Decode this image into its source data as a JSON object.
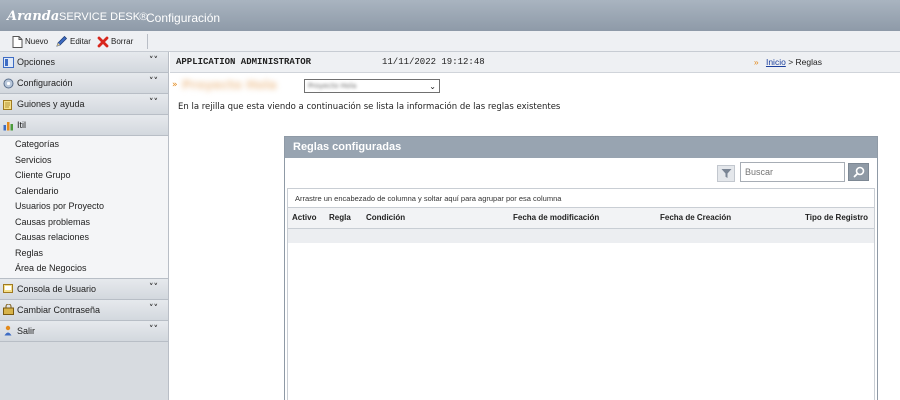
{
  "window": {
    "brand": "Aranda",
    "product": "SERVICE DESK",
    "registered": "®",
    "module": "Configuración"
  },
  "toolbar": {
    "new_label": "Nuevo",
    "edit_label": "Editar",
    "delete_label": "Borrar"
  },
  "sidebar": {
    "sections": [
      {
        "label": "Opciones",
        "icon": "options-icon"
      },
      {
        "label": "Configuración",
        "icon": "gear-icon"
      },
      {
        "label": "Guiones y ayuda",
        "icon": "script-help-icon"
      },
      {
        "label": "Itil",
        "icon": "itil-icon"
      }
    ],
    "itil_items": [
      "Categorías",
      "Servicios",
      "Cliente Grupo",
      "Calendario",
      "Usuarios por Proyecto",
      "Causas problemas",
      "Causas relaciones",
      "Reglas",
      "Área de Negocios"
    ],
    "bottom_sections": [
      {
        "label": "Consola de Usuario",
        "icon": "user-console-icon"
      },
      {
        "label": "Cambiar Contraseña",
        "icon": "change-password-icon"
      },
      {
        "label": "Salir",
        "icon": "exit-icon"
      }
    ]
  },
  "header": {
    "user": "APPLICATION ADMINISTRATOR",
    "datetime": "11/11/2022 19:12:48",
    "breadcrumb_home": "Inicio",
    "breadcrumb_sep": ">",
    "breadcrumb_current": "Reglas"
  },
  "project": {
    "name": "Proyecto Hola",
    "selected": "Proyecto Hola"
  },
  "description": "En la rejilla que esta viendo a continuación se lista la información de las reglas existentes",
  "panel": {
    "title": "Reglas configuradas",
    "search_placeholder": "Buscar",
    "group_hint": "Arrastre un encabezado de columna y soltar aquí para agrupar por esa columna",
    "columns": [
      "Activo",
      "Regla",
      "Condición",
      "Fecha de modificación",
      "Fecha de Creación",
      "Tipo de Registro"
    ]
  },
  "colors": {
    "accent_orange": "#e38a1c",
    "link_blue": "#1a3e9c",
    "panel_header": "#98a4b1",
    "sidebar_bg": "#d7dbe0"
  }
}
